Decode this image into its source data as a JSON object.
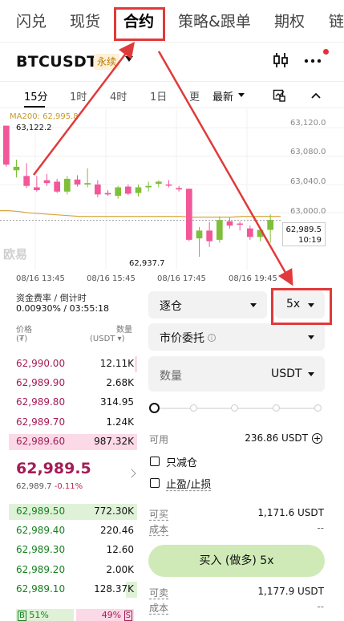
{
  "top_tabs": [
    "闪兑",
    "现货",
    "合约",
    "策略&跟单",
    "期权",
    "链"
  ],
  "symbol": "BTCUSDT",
  "perp_badge": "永续",
  "icons": {
    "chart_toggle": "candlestick-toggle-icon",
    "more": "more-dots-icon",
    "indicator": "indicator-icon",
    "collapse": "chevron-up-icon",
    "info": "info-icon",
    "add": "plus-circle-icon"
  },
  "intervals": [
    "15分",
    "1时",
    "4时",
    "1日",
    "更"
  ],
  "latest_label": "最新",
  "chart_data": {
    "type": "candlestick",
    "ma_label": "MA200: 62,995.8",
    "ylim": [
      62920,
      63135
    ],
    "y_ticks": [
      "63,120.0",
      "63,080.0",
      "63,040.0",
      "63,000.0"
    ],
    "x_ticks": [
      "08/16 13:45",
      "08/16 15:45",
      "08/16 17:45",
      "08/16 19:45"
    ],
    "high_label": "63,122.2",
    "low_label": "62,937.7",
    "current_price": "62,989.5",
    "countdown": "10:19",
    "candles": [
      {
        "o": 63123,
        "h": 63123,
        "l": 63065,
        "c": 63068
      },
      {
        "o": 63060,
        "h": 63075,
        "l": 63050,
        "c": 63065
      },
      {
        "o": 63052,
        "h": 63070,
        "l": 63035,
        "c": 63038
      },
      {
        "o": 63036,
        "h": 63052,
        "l": 63030,
        "c": 63032
      },
      {
        "o": 63046,
        "h": 63055,
        "l": 63038,
        "c": 63042
      },
      {
        "o": 63044,
        "h": 63048,
        "l": 63028,
        "c": 63030
      },
      {
        "o": 63030,
        "h": 63052,
        "l": 63026,
        "c": 63048
      },
      {
        "o": 63047,
        "h": 63053,
        "l": 63037,
        "c": 63040
      },
      {
        "o": 63040,
        "h": 63063,
        "l": 63036,
        "c": 63042
      },
      {
        "o": 63040,
        "h": 63046,
        "l": 63022,
        "c": 63026
      },
      {
        "o": 63028,
        "h": 63032,
        "l": 63024,
        "c": 63026
      },
      {
        "o": 63024,
        "h": 63038,
        "l": 63020,
        "c": 63036
      },
      {
        "o": 63037,
        "h": 63040,
        "l": 63025,
        "c": 63027
      },
      {
        "o": 63028,
        "h": 63040,
        "l": 63023,
        "c": 63036
      },
      {
        "o": 63036,
        "h": 63044,
        "l": 63030,
        "c": 63038
      },
      {
        "o": 63041,
        "h": 63046,
        "l": 63036,
        "c": 63044
      },
      {
        "o": 63040,
        "h": 63046,
        "l": 63036,
        "c": 63039
      },
      {
        "o": 63035,
        "h": 63038,
        "l": 63030,
        "c": 63033
      },
      {
        "o": 63034,
        "h": 63034,
        "l": 62960,
        "c": 62962
      },
      {
        "o": 62964,
        "h": 62980,
        "l": 62938,
        "c": 62975
      },
      {
        "o": 62975,
        "h": 62987,
        "l": 62952,
        "c": 62960
      },
      {
        "o": 62962,
        "h": 62995,
        "l": 62958,
        "c": 62990
      },
      {
        "o": 62988,
        "h": 62993,
        "l": 62978,
        "c": 62982
      },
      {
        "o": 62985,
        "h": 62988,
        "l": 62975,
        "c": 62984
      },
      {
        "o": 62978,
        "h": 62982,
        "l": 62962,
        "c": 62966
      },
      {
        "o": 62966,
        "h": 62978,
        "l": 62960,
        "c": 62976
      },
      {
        "o": 62976,
        "h": 62998,
        "l": 62958,
        "c": 62990
      }
    ],
    "ma": [
      63003,
      63002,
      63000,
      62999,
      62998,
      62997,
      62996,
      62995,
      62995,
      62995,
      62995,
      62995,
      62995,
      62995,
      62995,
      62995,
      62995,
      62995,
      62994,
      62994,
      62994,
      62994,
      62994,
      62995,
      62995,
      62995,
      62995
    ]
  },
  "watermark": "欧易",
  "funding": {
    "label": "资金费率 / 倒计时",
    "value": "0.00930% / 03:55:18"
  },
  "orderbook": {
    "price_header": "价格",
    "price_unit": "(₮)",
    "qty_header": "数量",
    "qty_unit": "(USDT ▾)",
    "asks": [
      {
        "price": "62,990.00",
        "size": "12.11K",
        "depth": 0.02
      },
      {
        "price": "62,989.90",
        "size": "2.68K",
        "depth": 0.0
      },
      {
        "price": "62,989.80",
        "size": "314.95",
        "depth": 0.0
      },
      {
        "price": "62,989.70",
        "size": "1.24K",
        "depth": 0.0
      },
      {
        "price": "62,989.60",
        "size": "987.32K",
        "depth": 1.0
      }
    ],
    "last_price": "62,989.5",
    "mark_price": "62,989.7",
    "change_pct": "-0.11%",
    "bids": [
      {
        "price": "62,989.50",
        "size": "772.30K",
        "depth": 1.0
      },
      {
        "price": "62,989.40",
        "size": "220.46",
        "depth": 0.0
      },
      {
        "price": "62,989.30",
        "size": "12.60",
        "depth": 0.0
      },
      {
        "price": "62,989.20",
        "size": "2.00K",
        "depth": 0.0
      },
      {
        "price": "62,989.10",
        "size": "128.37K",
        "depth": 0.09
      }
    ],
    "buy_ratio_label": "B",
    "buy_ratio": "51%",
    "sell_ratio": "49%",
    "sell_ratio_label": "S"
  },
  "trade": {
    "margin_mode": "逐仓",
    "leverage": "5x",
    "order_type": "市价委托",
    "qty_placeholder": "数量",
    "qty_unit": "USDT",
    "available_label": "可用",
    "available_value": "236.86 USDT",
    "reduce_only": "只减仓",
    "tp_sl": "止盈/止损",
    "can_buy_label": "可买",
    "can_buy_value": "1,171.6 USDT",
    "cost_label_1": "成本",
    "cost_value_1": "--",
    "buy_button": "买入 (做多) 5x",
    "can_sell_label": "可卖",
    "can_sell_value": "1,177.9 USDT",
    "cost_label_2": "成本",
    "cost_value_2": "--"
  },
  "colors": {
    "up": "#7fbf3a",
    "down": "#f25799",
    "ma": "#d8a53a",
    "annotation": "#e03a3a",
    "buy_button": "#cfeab7"
  }
}
